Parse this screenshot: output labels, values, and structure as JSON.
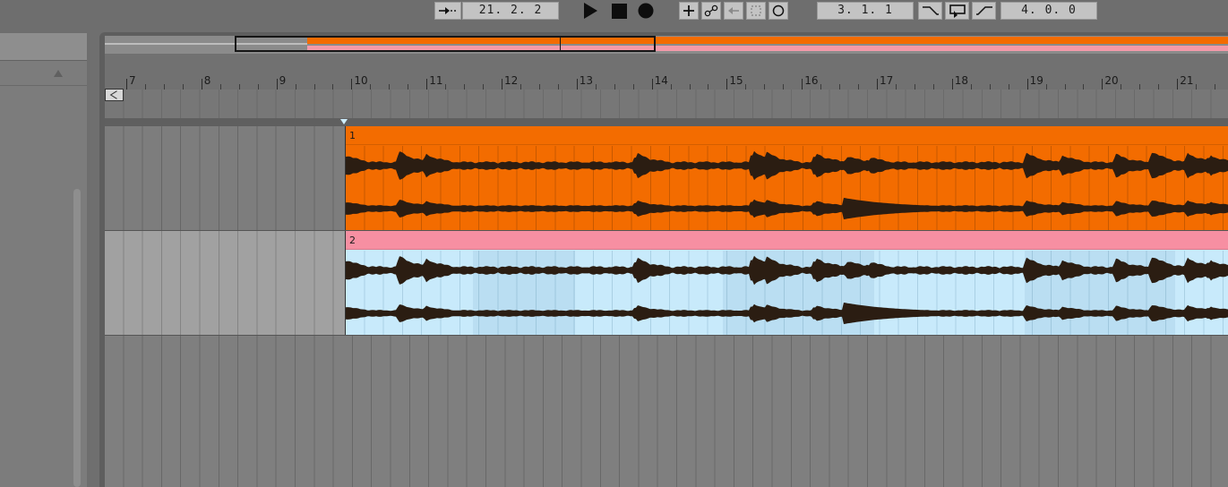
{
  "transport": {
    "follow_icon": "arrow-right-dash-icon",
    "song_position": "21.  2.  2",
    "play_icon": "play-icon",
    "stop_icon": "stop-icon",
    "record_icon": "record-icon",
    "add_icon": "plus-icon",
    "automation_icon": "automation-icon",
    "back_to_arrangement_icon": "back-arrow-icon",
    "punch_icon": "punch-icon",
    "loop_record_icon": "circle-icon",
    "loop_start": "3.  1.  1",
    "punch_in_icon": "punch-in-icon",
    "loop_toggle_icon": "loop-icon",
    "punch_out_icon": "punch-out-icon",
    "loop_length": "4.  0.  0"
  },
  "ruler": {
    "bars": [
      "7",
      "8",
      "9",
      "10",
      "11",
      "12",
      "13",
      "14",
      "15",
      "16",
      "17",
      "18",
      "19",
      "20",
      "21"
    ]
  },
  "tracks": [
    {
      "clip_name": "1",
      "color": "#f36c00"
    },
    {
      "clip_name": "2",
      "color": "#f78fa2",
      "body_color": "#c8eafb"
    }
  ]
}
